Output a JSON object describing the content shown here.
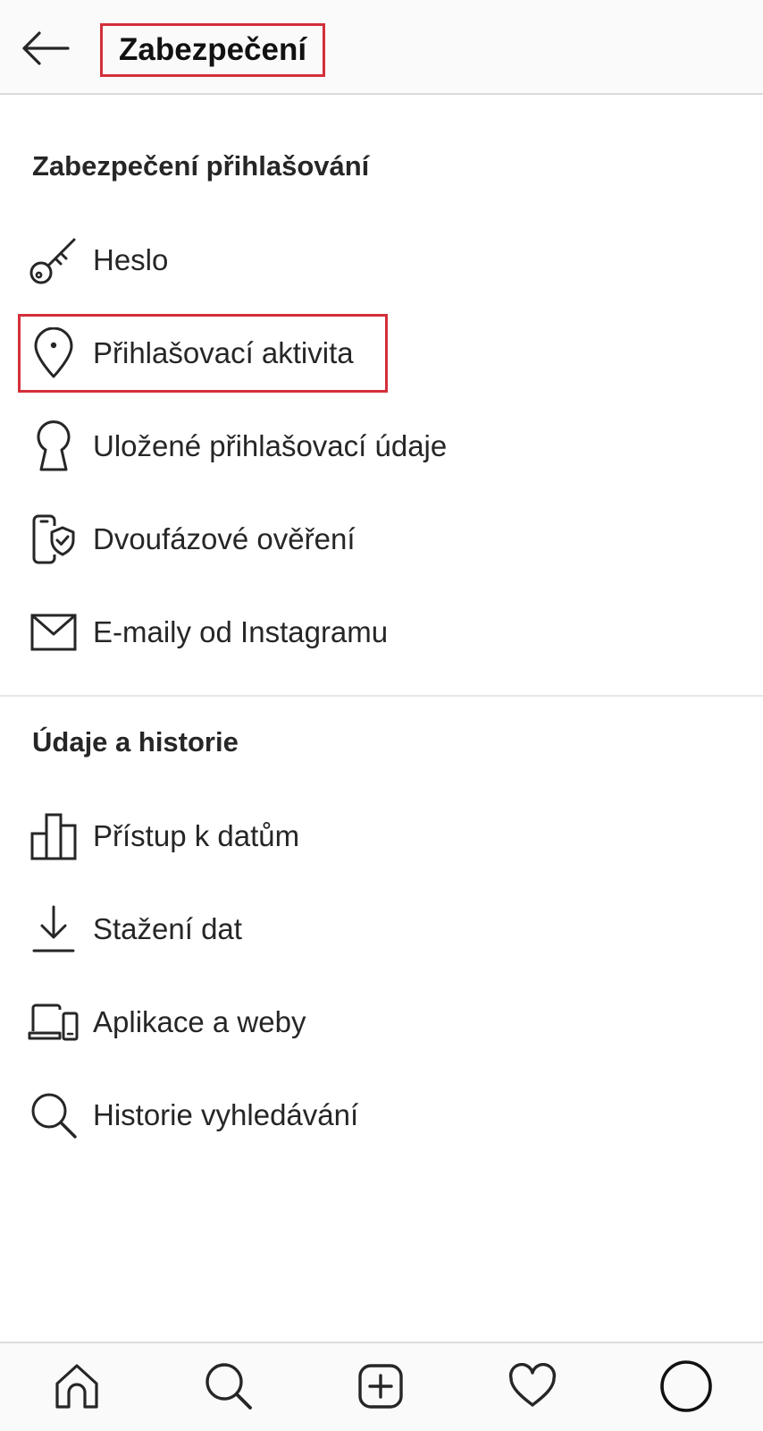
{
  "header": {
    "title": "Zabezpečení"
  },
  "sections": [
    {
      "title": "Zabezpečení přihlašování",
      "items": [
        {
          "label": "Heslo",
          "icon": "key-icon"
        },
        {
          "label": "Přihlašovací aktivita",
          "icon": "location-pin-icon"
        },
        {
          "label": "Uložené přihlašovací údaje",
          "icon": "keyhole-icon"
        },
        {
          "label": "Dvoufázové ověření",
          "icon": "phone-shield-icon"
        },
        {
          "label": "E-maily od Instagramu",
          "icon": "mail-icon"
        }
      ]
    },
    {
      "title": "Údaje a historie",
      "items": [
        {
          "label": "Přístup k datům",
          "icon": "bar-chart-icon"
        },
        {
          "label": "Stažení dat",
          "icon": "download-icon"
        },
        {
          "label": "Aplikace a weby",
          "icon": "laptop-phone-icon"
        },
        {
          "label": "Historie vyhledávání",
          "icon": "search-icon"
        }
      ]
    }
  ],
  "bottom_nav": [
    "home-icon",
    "search-icon",
    "add-post-icon",
    "heart-icon",
    "profile-icon"
  ],
  "colors": {
    "highlight": "#d32f3a",
    "text": "#262626",
    "background": "#ffffff",
    "bar_background": "#fafafa"
  }
}
